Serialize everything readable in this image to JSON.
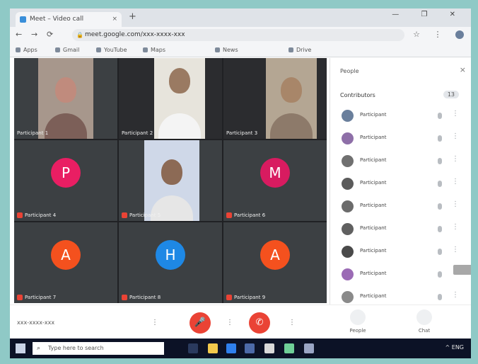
{
  "browser": {
    "tab_title": "Meet – Video call",
    "tab_close": "×",
    "new_tab": "+",
    "window_controls": "— ❐ ✕",
    "url": "meet.google.com/xxx-xxxx-xxx",
    "nav_back": "←",
    "nav_forward": "→",
    "nav_reload": "⟳",
    "lock": "🔒",
    "addr_actions": "☆ ⋮",
    "bookmarks": [
      "Apps",
      "Gmail",
      "YouTube",
      "Maps",
      "News",
      "Drive"
    ]
  },
  "tiles": [
    {
      "name": "Participant 1",
      "kind": "camera",
      "avatar": ""
    },
    {
      "name": "Participant 2",
      "kind": "camera",
      "avatar": ""
    },
    {
      "name": "Participant 3",
      "kind": "camera",
      "avatar": ""
    },
    {
      "name": "Participant 4",
      "kind": "avatar",
      "avatar": "P",
      "color": "#e91e63"
    },
    {
      "name": "Participant 5",
      "kind": "camera",
      "avatar": ""
    },
    {
      "name": "Participant 6",
      "kind": "avatar",
      "avatar": "M",
      "color": "#d81b60"
    },
    {
      "name": "Participant 7",
      "kind": "avatar",
      "avatar": "A",
      "color": "#f4511e"
    },
    {
      "name": "Participant 8",
      "kind": "avatar",
      "avatar": "H",
      "color": "#1e88e5"
    },
    {
      "name": "Participant 9",
      "kind": "avatar",
      "avatar": "A",
      "color": "#f4511e"
    }
  ],
  "panel": {
    "title": "People",
    "close": "×",
    "section_label": "Contributors",
    "section_count": "13",
    "participants": [
      {
        "name": "Participant",
        "color": "#6a7f9c"
      },
      {
        "name": "Participant",
        "color": "#8e6fa8"
      },
      {
        "name": "Participant",
        "color": "#707070"
      },
      {
        "name": "Participant",
        "color": "#5b5b5b"
      },
      {
        "name": "Participant",
        "color": "#6b6b6b"
      },
      {
        "name": "Participant",
        "color": "#606060"
      },
      {
        "name": "Participant",
        "color": "#4a4a4a"
      },
      {
        "name": "Participant",
        "color": "#9b6bb5"
      },
      {
        "name": "Participant",
        "color": "#8a8a8a"
      }
    ],
    "more": "⋮"
  },
  "callbar": {
    "meeting_code": "xxx-xxxx-xxx",
    "end_call_icon": "✆",
    "mic_icon": "🎤",
    "more": "⋮",
    "people_label": "People",
    "chat_label": "Chat"
  },
  "taskbar": {
    "search_placeholder": "Type here to search",
    "search_icon": "⌕",
    "tray_text": "^ ENG"
  },
  "colors": {
    "grid_bg": "#202124",
    "end_call_red": "#ea4335",
    "taskbar_bg": "#0c1226",
    "frame_bg": "#8fc9c6"
  }
}
